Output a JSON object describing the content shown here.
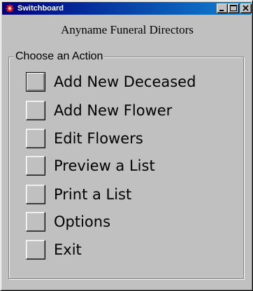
{
  "window": {
    "title": "Switchboard",
    "accent_color": "#000080"
  },
  "titlebar_buttons": [
    {
      "name": "minimize",
      "icon": "minimize-icon"
    },
    {
      "name": "maximize",
      "icon": "maximize-icon"
    },
    {
      "name": "close",
      "icon": "close-icon"
    }
  ],
  "header": {
    "company_name": "Anyname Funeral Directors"
  },
  "group": {
    "label": "Choose an Action"
  },
  "actions": [
    {
      "label": "Add New Deceased"
    },
    {
      "label": "Add New Flower"
    },
    {
      "label": "Edit Flowers"
    },
    {
      "label": "Preview a List"
    },
    {
      "label": "Print a List"
    },
    {
      "label": "Options"
    },
    {
      "label": "Exit"
    }
  ]
}
